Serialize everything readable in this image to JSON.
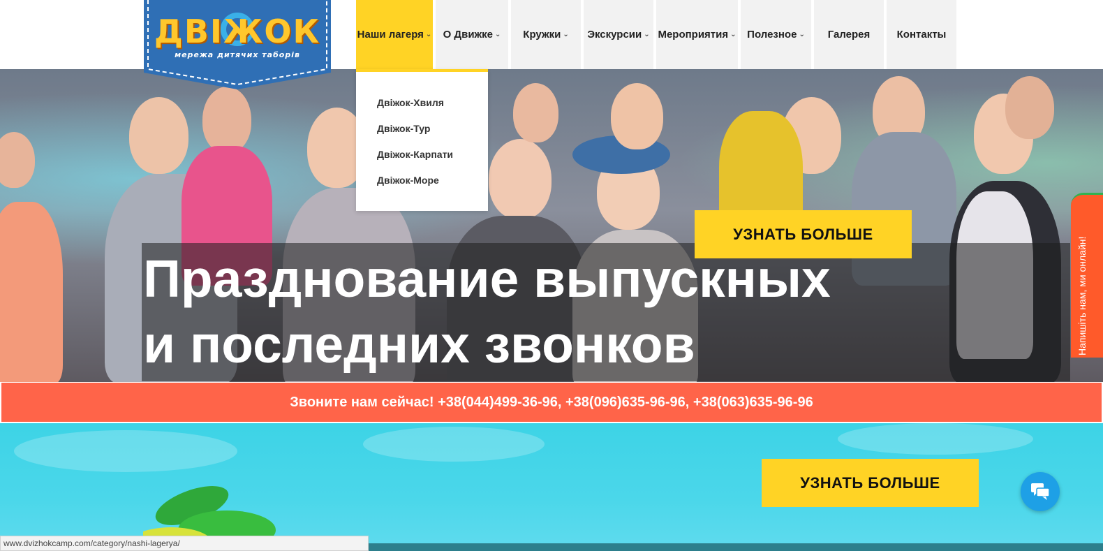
{
  "logo": {
    "word": "ДВІЖОК",
    "subtitle": "мережа дитячих таборів"
  },
  "nav": {
    "items": [
      {
        "label": "Наши лагеря",
        "dropdown": true,
        "active": true
      },
      {
        "label": "О Движке",
        "dropdown": true,
        "active": false
      },
      {
        "label": "Кружки",
        "dropdown": true,
        "active": false
      },
      {
        "label": "Экскурсии",
        "dropdown": true,
        "active": false
      },
      {
        "label": "Мероприятия",
        "dropdown": true,
        "active": false
      },
      {
        "label": "Полезное",
        "dropdown": true,
        "active": false
      },
      {
        "label": "Галерея",
        "dropdown": false,
        "active": false
      },
      {
        "label": "Контакты",
        "dropdown": false,
        "active": false
      }
    ],
    "dropdown_icon": "chevron-down-icon"
  },
  "dropdown": {
    "items": [
      "Двіжок-Хвиля",
      "Двіжок-Тур",
      "Двіжок-Карпати",
      "Двіжок-Море"
    ]
  },
  "hero": {
    "button_label": "УЗНАТЬ БОЛЬШЕ",
    "title_line1": "Празднование выпускных",
    "title_line2": "и последних звонков"
  },
  "callbar": {
    "text": "Звоните нам сейчас! +38(044)499-36-96, +38(096)635-96-96, +38(063)635-96-96"
  },
  "lower": {
    "button_label": "УЗНАТЬ БОЛЬШЕ"
  },
  "side_tab": {
    "label": "Напишіть нам, ми онлайн!"
  },
  "chat": {
    "icon": "chat-bubble-icon"
  },
  "status_bar": {
    "url": "www.dvizhokcamp.com/category/nashi-lagerya/"
  },
  "colors": {
    "accent_yellow": "#ffd325",
    "call_bar": "#ff6449",
    "side_tab": "#ff5a2a",
    "chat": "#1ea0e6",
    "logo_blue": "#2f6fb5",
    "sky": "#3dd3e6"
  }
}
